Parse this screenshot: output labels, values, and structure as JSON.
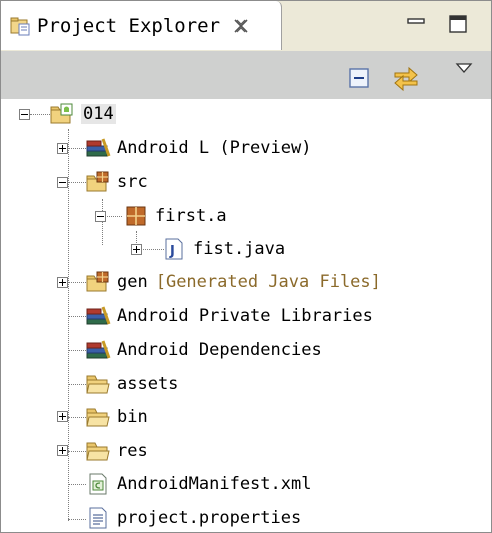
{
  "view": {
    "title": "Project Explorer",
    "icons": {
      "tab": "project-explorer-icon",
      "close": "close-icon",
      "minimize": "minimize-icon",
      "maximize": "maximize-icon",
      "collapse_all": "collapse-all-icon",
      "link_with_editor": "link-with-editor-icon",
      "view_menu": "view-menu-icon"
    }
  },
  "tree": {
    "project": {
      "label": "014",
      "icon": "android-project-folder-icon"
    },
    "items": [
      {
        "label": "Android L (Preview)",
        "icon": "library-icon"
      },
      {
        "label": "src",
        "icon": "source-folder-icon"
      },
      {
        "label": "first.a",
        "icon": "package-icon"
      },
      {
        "label": "fist.java",
        "icon": "java-file-icon"
      },
      {
        "label": "gen",
        "decoration": "[Generated Java Files]",
        "icon": "generated-source-folder-icon"
      },
      {
        "label": "Android Private Libraries",
        "icon": "library-icon"
      },
      {
        "label": "Android Dependencies",
        "icon": "library-icon"
      },
      {
        "label": "assets",
        "icon": "folder-icon"
      },
      {
        "label": "bin",
        "icon": "folder-icon"
      },
      {
        "label": "res",
        "icon": "folder-icon"
      },
      {
        "label": "AndroidManifest.xml",
        "icon": "xml-file-icon"
      },
      {
        "label": "project.properties",
        "icon": "properties-file-icon"
      }
    ]
  },
  "colors": {
    "toolbar": "#cfd0cf",
    "decoration_text": "#8b6a2b",
    "selection": "#e6e6e6"
  }
}
